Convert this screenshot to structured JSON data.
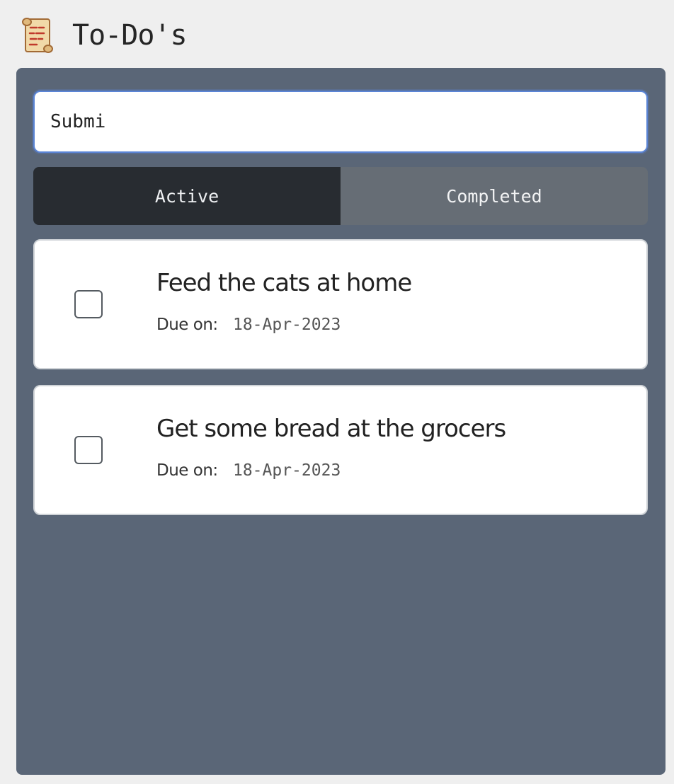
{
  "header": {
    "title": "To-Do's",
    "logo_icon": "scroll-icon"
  },
  "input": {
    "value": "Submi",
    "focus_color": "#5b85d6"
  },
  "tabs": [
    {
      "label": "Active",
      "selected": true
    },
    {
      "label": "Completed",
      "selected": false
    }
  ],
  "tasks": [
    {
      "title": "Feed the cats at home",
      "due_label": "Due on:",
      "due_date": "18-Apr-2023",
      "completed": false
    },
    {
      "title": "Get some bread at the grocers",
      "due_label": "Due on:",
      "due_date": "18-Apr-2023",
      "completed": false
    }
  ],
  "colors": {
    "page_background": "#efefef",
    "panel_background": "#5a6677",
    "active_tab": "#282c31",
    "inactive_tab": "#666d75"
  }
}
